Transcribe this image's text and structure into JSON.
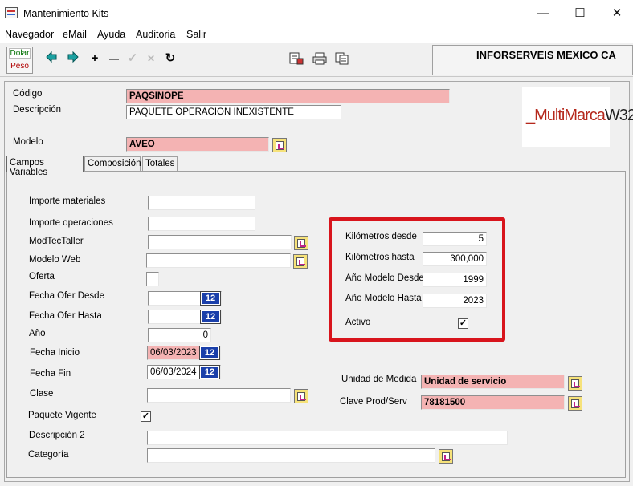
{
  "window": {
    "title": "Mantenimiento Kits",
    "minimize": "—",
    "maximize": "☐",
    "close": "✕"
  },
  "menu": [
    "Navegador",
    "eMail",
    "Ayuda",
    "Auditoria",
    "Salir"
  ],
  "toolbar": {
    "dolar": "Dolar",
    "peso": "Peso",
    "back": "◆",
    "next": "➔",
    "add": "+",
    "remove": "—",
    "confirm": "✓",
    "cancel": "✕",
    "refresh": "↻",
    "company": "INFORSERVEIS MEXICO CA"
  },
  "header": {
    "codigo_label": "Código",
    "codigo": "PAQSINOPE",
    "descripcion_label": "Descripción",
    "descripcion": "PAQUETE OPERACION INEXISTENTE",
    "modelo_label": "Modelo",
    "modelo": "AVEO"
  },
  "logo": {
    "red": "_MultiMarca",
    "dark": "W32"
  },
  "tabs": [
    "Campos Variables",
    "Composición",
    "Totales"
  ],
  "fields": {
    "importe_materiales": {
      "label": "Importe materiales",
      "value": ""
    },
    "importe_operaciones": {
      "label": "Importe operaciones",
      "value": ""
    },
    "modtec_taller": {
      "label": "ModTecTaller",
      "value": ""
    },
    "modelo_web": {
      "label": "Modelo Web",
      "value": ""
    },
    "oferta": {
      "label": "Oferta",
      "value": ""
    },
    "fecha_ofer_desde": {
      "label": "Fecha Ofer Desde",
      "value": ""
    },
    "fecha_ofer_hasta": {
      "label": "Fecha Ofer Hasta",
      "value": ""
    },
    "anio": {
      "label": "Año",
      "value": "0"
    },
    "fecha_inicio": {
      "label": "Fecha Inicio",
      "value": "06/03/2023"
    },
    "fecha_fin": {
      "label": "Fecha Fin",
      "value": "06/03/2024"
    },
    "clase": {
      "label": "Clase",
      "value": ""
    },
    "paquete_vigente": {
      "label": "Paquete Vigente",
      "checked": "✓"
    },
    "descripcion2": {
      "label": "Descripción 2",
      "value": ""
    },
    "categoria": {
      "label": "Categoría",
      "value": ""
    },
    "km_desde": {
      "label": "Kilómetros desde",
      "value": "5"
    },
    "km_hasta": {
      "label": "Kilómetros hasta",
      "value": "300,000"
    },
    "anio_modelo_desde": {
      "label": "Año Modelo Desde",
      "value": "1999"
    },
    "anio_modelo_hasta": {
      "label": "Año Modelo Hasta",
      "value": "2023"
    },
    "activo": {
      "label": "Activo",
      "checked": "✓"
    },
    "unidad_medida": {
      "label": "Unidad de Medida",
      "value": "Unidad de servicio"
    },
    "clave_prod_serv": {
      "label": "Clave Prod/Serv",
      "value": "78181500"
    }
  },
  "calendar_label": "12",
  "colors": {
    "required_field": "#f4b3b3",
    "highlight": "#d8141c"
  }
}
